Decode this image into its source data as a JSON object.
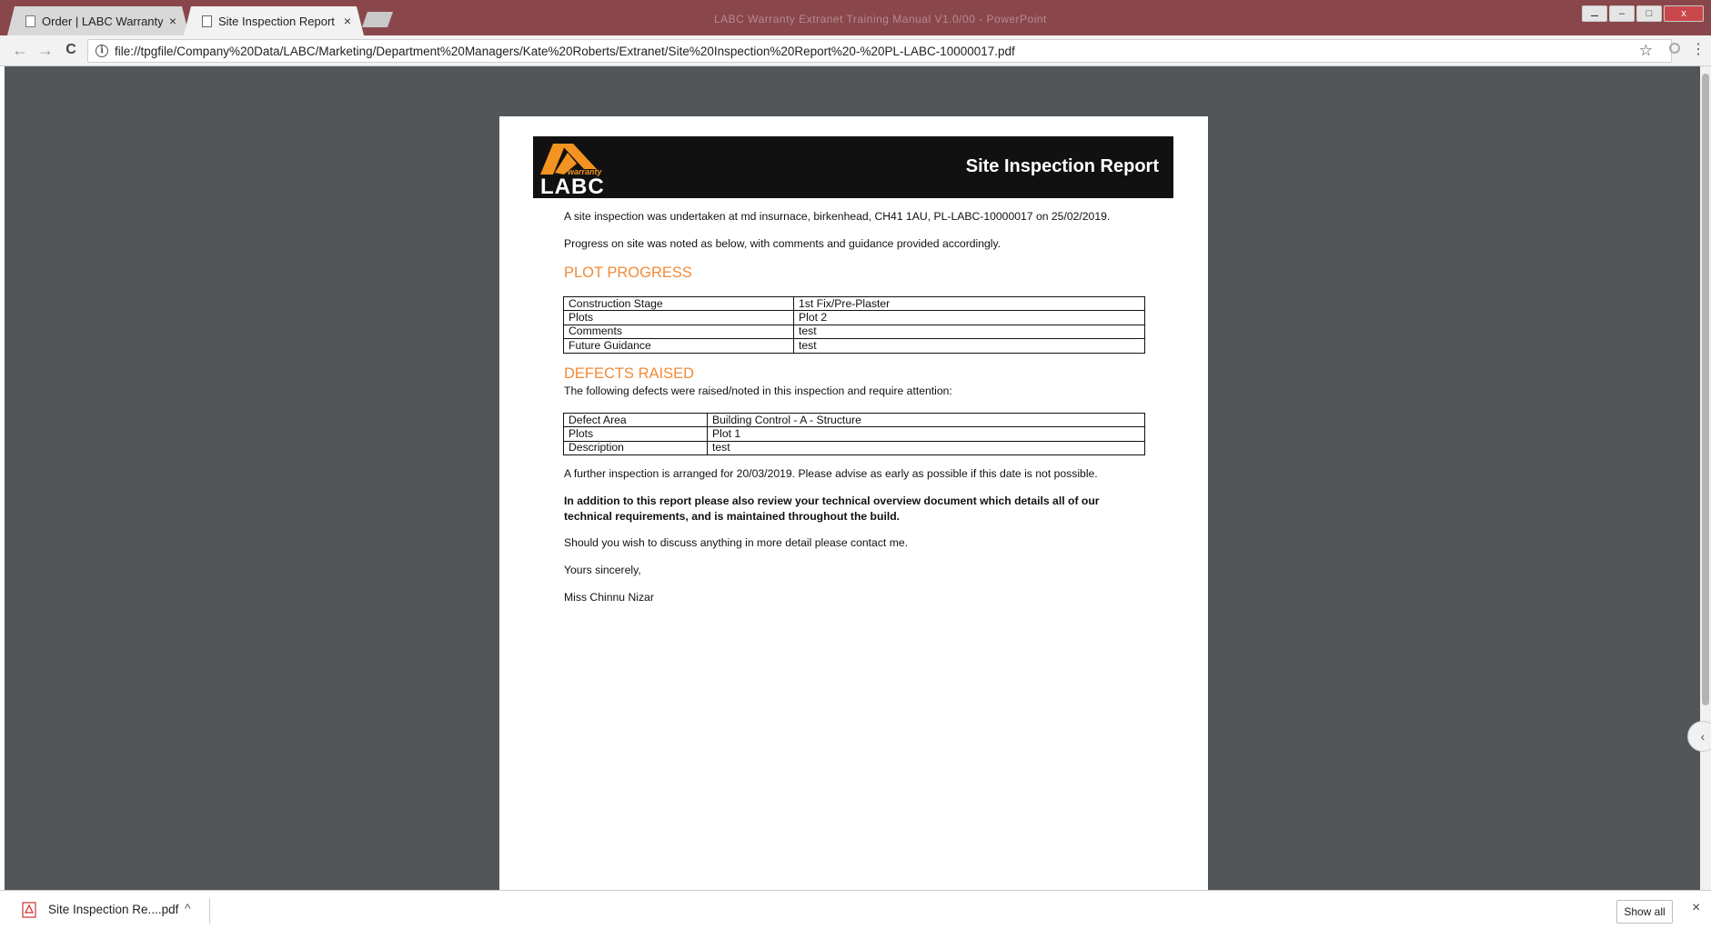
{
  "browser": {
    "tabs": [
      {
        "title": "Order | LABC Warranty",
        "active": false
      },
      {
        "title": "Site Inspection Report - (",
        "active": true
      }
    ],
    "window_title": "LABC Warranty Extranet Training Manual V1.0/00 - PowerPoint",
    "url": "file://tpgfile/Company%20Data/LABC/Marketing/Department%20Managers/Kate%20Roberts/Extranet/Site%20Inspection%20Report%20-%20PL-LABC-10000017.pdf",
    "nav": {
      "back": "←",
      "forward": "→",
      "reload": "C"
    },
    "bookmark_icon": "star-icon",
    "menu_icon": "⋮",
    "minimize": "–",
    "maximize": "□",
    "close": "x",
    "close_tab": "×"
  },
  "report": {
    "logo": {
      "small": "warranty",
      "big": "LABC"
    },
    "banner_title": "Site Inspection Report",
    "intro": "A site inspection was undertaken at md insurnace, birkenhead, CH41 1AU, PL-LABC-10000017 on 25/02/2019.",
    "progress_note": "Progress on site was noted as below, with comments and guidance provided accordingly.",
    "plot_heading": "PLOT PROGRESS",
    "plot_rows": [
      {
        "label": "Construction Stage",
        "value": "1st Fix/Pre-Plaster"
      },
      {
        "label": "Plots",
        "value": "Plot 2"
      },
      {
        "label": "Comments",
        "value": "test"
      },
      {
        "label": "Future Guidance",
        "value": "test"
      }
    ],
    "defects_heading": "DEFECTS RAISED",
    "defects_intro": "The following defects were raised/noted in this inspection and require attention:",
    "defect_rows": [
      {
        "label": "Defect Area",
        "value": "Building Control - A - Structure"
      },
      {
        "label": "Plots",
        "value": "Plot 1"
      },
      {
        "label": "Description",
        "value": "test"
      }
    ],
    "further": "A further inspection is arranged for 20/03/2019. Please advise as early as possible if this date is not possible.",
    "bold_note": "In addition to this report please also review your technical overview document which details all of our technical requirements, and is maintained throughout the build.",
    "contact": "Should you wish to discuss anything in more detail please contact me.",
    "signoff": "Yours sincerely,",
    "signature": "Miss Chinnu Nizar"
  },
  "downloads": {
    "file": "Site Inspection Re....pdf",
    "chevron": "^",
    "show_all": "Show all",
    "close": "×"
  },
  "colors": {
    "accent": "#f28a36",
    "tabbar": "#8a474b",
    "viewer_bg": "#525659"
  }
}
